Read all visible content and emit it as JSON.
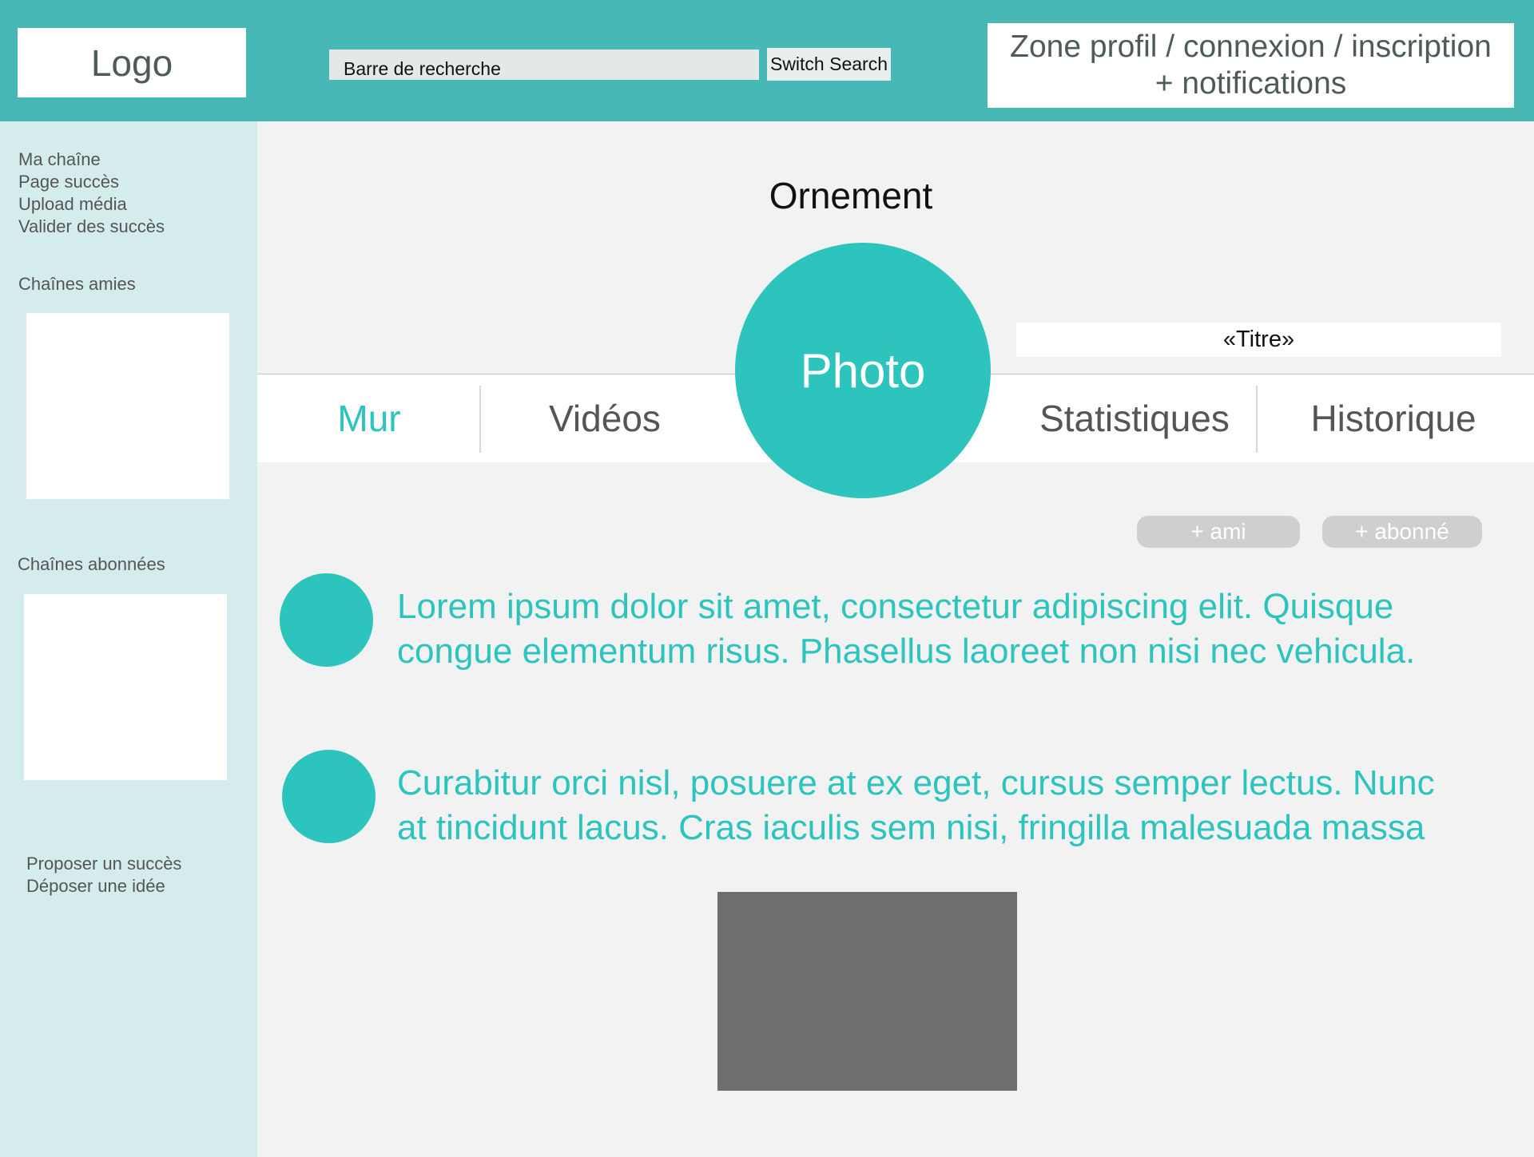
{
  "header": {
    "logo": "Logo",
    "search_placeholder": "Barre de recherche",
    "switch_search": "Switch Search",
    "profile_zone_line1": "Zone profil / connexion / inscription",
    "profile_zone_line2": "+ notifications"
  },
  "sidebar": {
    "menu": [
      "Ma chaîne",
      "Page succès",
      "Upload média",
      "Valider des succès"
    ],
    "friends_heading": "Chaînes amies",
    "subscribed_heading": "Chaînes abonnées",
    "bottom_links": [
      "Proposer un succès",
      "Déposer une idée"
    ]
  },
  "channel": {
    "ornament": "Ornement",
    "title": "«Titre»",
    "photo": "Photo",
    "tabs": [
      "Mur",
      "Vidéos",
      "Statistiques",
      "Historique"
    ],
    "active_tab": "Mur",
    "add_friend": "+ ami",
    "subscribe": "+ abonné"
  },
  "posts": [
    {
      "line1": "Lorem ipsum dolor sit amet, consectetur adipiscing elit. Quisque",
      "line2": "congue elementum risus. Phasellus laoreet non nisi nec vehicula."
    },
    {
      "line1": "Curabitur orci nisl, posuere at ex eget, cursus semper lectus. Nunc",
      "line2": "at tincidunt lacus. Cras iaculis sem nisi, fringilla malesuada massa"
    }
  ],
  "colors": {
    "header": "#47b8b5",
    "accent": "#2cc4bd",
    "sidebar": "#d5ecec",
    "media_placeholder": "#6f6e6f"
  }
}
